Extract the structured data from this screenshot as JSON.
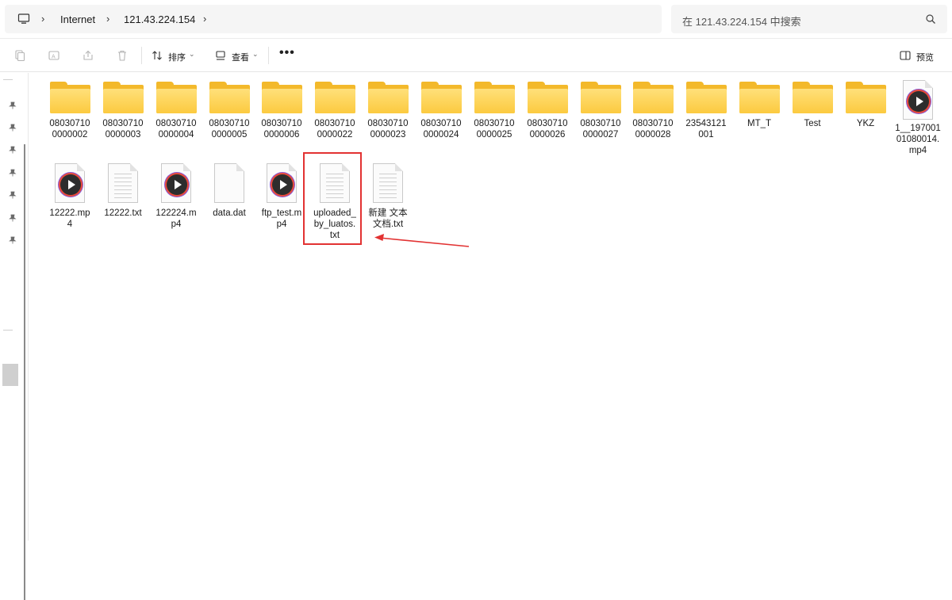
{
  "address": {
    "crumbs": [
      "Internet",
      "121.43.224.154"
    ],
    "search_placeholder": "在 121.43.224.154 中搜索"
  },
  "toolbar": {
    "sort_label": "排序",
    "view_label": "查看",
    "more_label": "•••",
    "preview_label": "预览"
  },
  "files": [
    {
      "name": "08030710\n0000002",
      "type": "folder"
    },
    {
      "name": "08030710\n0000003",
      "type": "folder"
    },
    {
      "name": "08030710\n0000004",
      "type": "folder"
    },
    {
      "name": "08030710\n0000005",
      "type": "folder"
    },
    {
      "name": "08030710\n0000006",
      "type": "folder"
    },
    {
      "name": "08030710\n0000022",
      "type": "folder"
    },
    {
      "name": "08030710\n0000023",
      "type": "folder"
    },
    {
      "name": "08030710\n0000024",
      "type": "folder"
    },
    {
      "name": "08030710\n0000025",
      "type": "folder"
    },
    {
      "name": "08030710\n0000026",
      "type": "folder"
    },
    {
      "name": "08030710\n0000027",
      "type": "folder"
    },
    {
      "name": "08030710\n0000028",
      "type": "folder"
    },
    {
      "name": "23543121\n001",
      "type": "folder"
    },
    {
      "name": "MT_T",
      "type": "folder"
    },
    {
      "name": "Test",
      "type": "folder"
    },
    {
      "name": "YKZ",
      "type": "folder"
    },
    {
      "name": "1__197001\n01080014.\nmp4",
      "type": "video"
    },
    {
      "name": "12222.mp\n4",
      "type": "video"
    },
    {
      "name": "12222.txt",
      "type": "text"
    },
    {
      "name": "122224.m\np4",
      "type": "video"
    },
    {
      "name": "data.dat",
      "type": "blank"
    },
    {
      "name": "ftp_test.m\np4",
      "type": "video"
    },
    {
      "name": "uploaded_\nby_luatos.\ntxt",
      "type": "text"
    },
    {
      "name": "新建 文本\n文档.txt",
      "type": "text"
    }
  ]
}
